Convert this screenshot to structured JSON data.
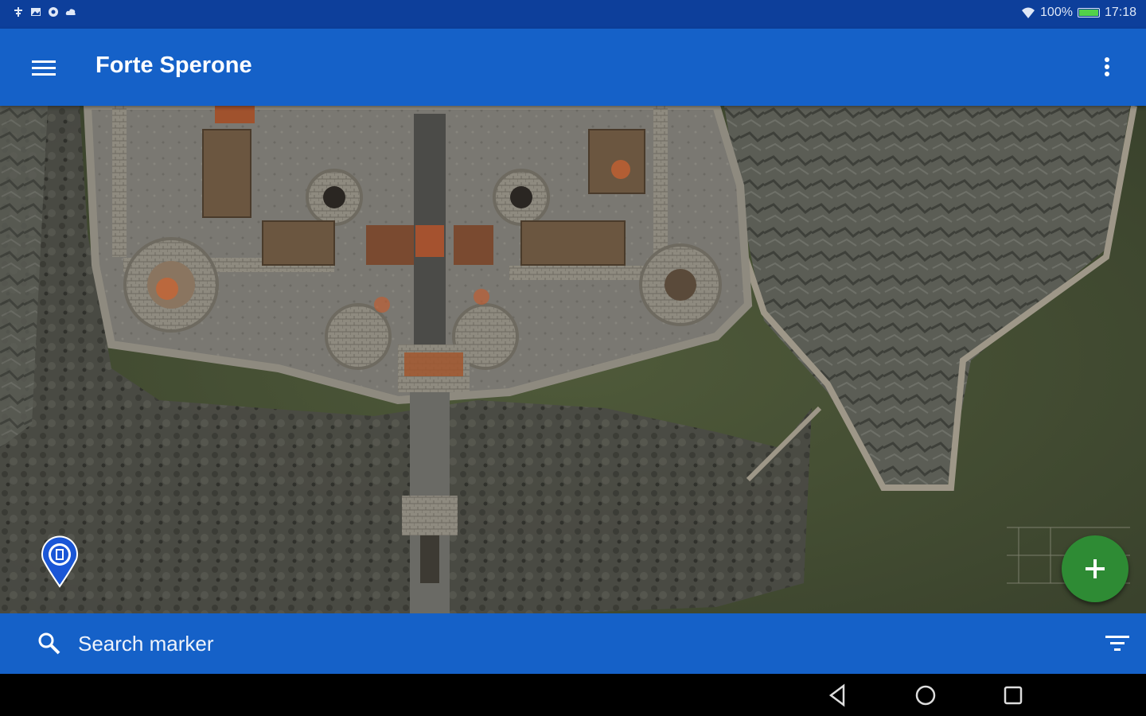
{
  "status_bar": {
    "battery_percent_text": "100%",
    "battery_level": 1.0,
    "time": "17:18",
    "left_icons": [
      "signal-icon",
      "gallery-icon",
      "settings-icon",
      "cloud-icon"
    ],
    "right_icons": [
      "wifi-icon",
      "battery-icon"
    ]
  },
  "app_bar": {
    "title": "Forte Sperone",
    "left_icon": "hamburger-menu-icon",
    "right_icon": "more-vert-icon"
  },
  "map": {
    "marker_icon": "location-pin-icon",
    "fab_icon": "plus-icon"
  },
  "search": {
    "placeholder": "Search marker",
    "icon": "search-icon",
    "filter_icon": "filter-icon"
  },
  "nav_bar": {
    "icons": [
      "back-icon",
      "home-icon",
      "recents-icon"
    ]
  },
  "colors": {
    "status_bar": "#0d3f9b",
    "app_bar": "#1561c8",
    "fab": "#2e8b34",
    "marker": "#1a56d6"
  }
}
